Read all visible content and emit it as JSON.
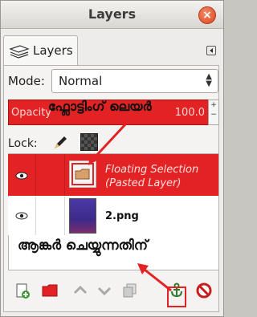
{
  "window": {
    "title": "Layers"
  },
  "tab": {
    "label": "Layers"
  },
  "mode": {
    "label": "Mode:",
    "value": "Normal"
  },
  "opacity": {
    "label": "Opacity",
    "value": "100.0"
  },
  "lock": {
    "label": "Lock:"
  },
  "layers": [
    {
      "name_line1": "Floating Selection",
      "name_line2": "(Pasted Layer)",
      "selected": true
    },
    {
      "name": "2.png",
      "selected": false
    }
  ],
  "annotations": {
    "top": "ഫ്ലോട്ടിംഗ് ലെയർ",
    "bottom": "ആങ്കർ ചെയ്യുന്നതിന്"
  },
  "colors": {
    "selection": "#e32224",
    "annotation_arrow": "#e32224"
  },
  "toolbar_icons": [
    "new-layer-icon",
    "new-layer-group-icon",
    "raise-layer-icon",
    "lower-layer-icon",
    "duplicate-layer-icon",
    "anchor-layer-icon",
    "delete-layer-icon"
  ]
}
